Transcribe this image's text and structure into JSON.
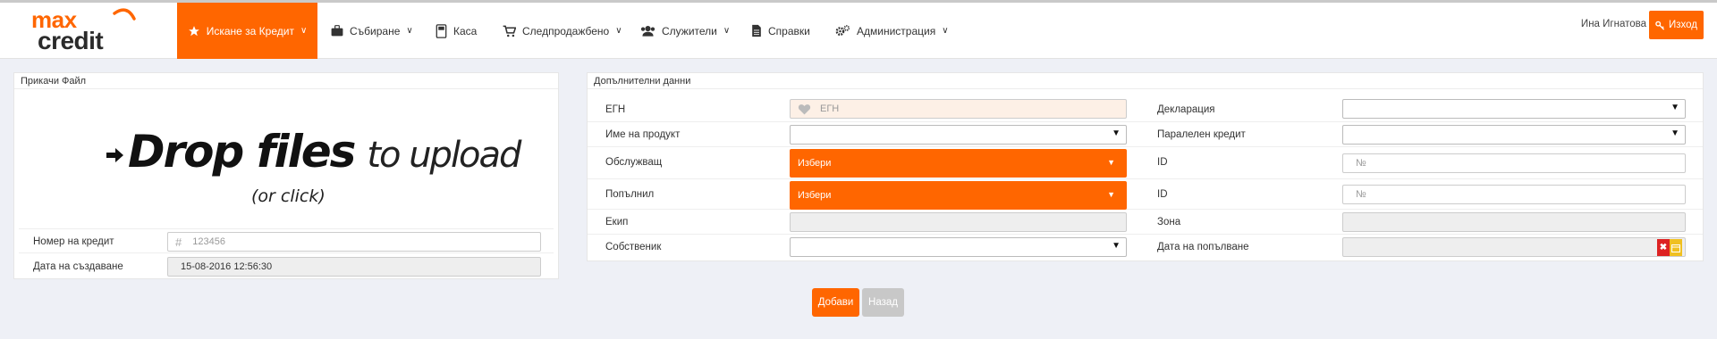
{
  "brand": {
    "logo_top": "max",
    "logo_bottom": "credit",
    "accent": "#ff6600"
  },
  "nav": {
    "items": [
      {
        "label": "Искане за Кредит",
        "icon": "star-icon",
        "dropdown": true,
        "active": true
      },
      {
        "label": "Събиране",
        "icon": "briefcase-icon",
        "dropdown": true
      },
      {
        "label": "Каса",
        "icon": "cash-register-icon",
        "dropdown": false
      },
      {
        "label": "Следпродажбено",
        "icon": "cart-icon",
        "dropdown": true
      },
      {
        "label": "Служители",
        "icon": "users-icon",
        "dropdown": true
      },
      {
        "label": "Справки",
        "icon": "document-icon",
        "dropdown": false
      },
      {
        "label": "Администрация",
        "icon": "gears-icon",
        "dropdown": true
      }
    ],
    "user_name": "Ина Игнатова",
    "logout_label": "Изход"
  },
  "attach_panel": {
    "title": "Прикачи Файл",
    "dropzone": {
      "strong": "Drop files",
      "thin": "to upload",
      "hint": "(or click)"
    },
    "credit_number": {
      "label": "Номер на кредит",
      "placeholder": "123456"
    },
    "created_date": {
      "label": "Дата на създаване",
      "value": "15-08-2016 12:56:30"
    }
  },
  "extra_panel": {
    "title": "Допълнителни данни",
    "egn": {
      "label": "ЕГН",
      "placeholder": "ЕГН"
    },
    "product": {
      "label": "Име на продукт"
    },
    "serving": {
      "label": "Обслужващ",
      "value": "Избери"
    },
    "filled_by": {
      "label": "Попълнил",
      "value": "Избери"
    },
    "team": {
      "label": "Екип"
    },
    "owner": {
      "label": "Собственик"
    },
    "declaration": {
      "label": "Декларация"
    },
    "parallel_credit": {
      "label": "Паралелен кредит"
    },
    "id1": {
      "label": "ID",
      "placeholder": "№"
    },
    "id2": {
      "label": "ID",
      "placeholder": "№"
    },
    "zone": {
      "label": "Зона"
    },
    "fill_date": {
      "label": "Дата на попълване"
    }
  },
  "actions": {
    "add": "Добави",
    "back": "Назад"
  }
}
